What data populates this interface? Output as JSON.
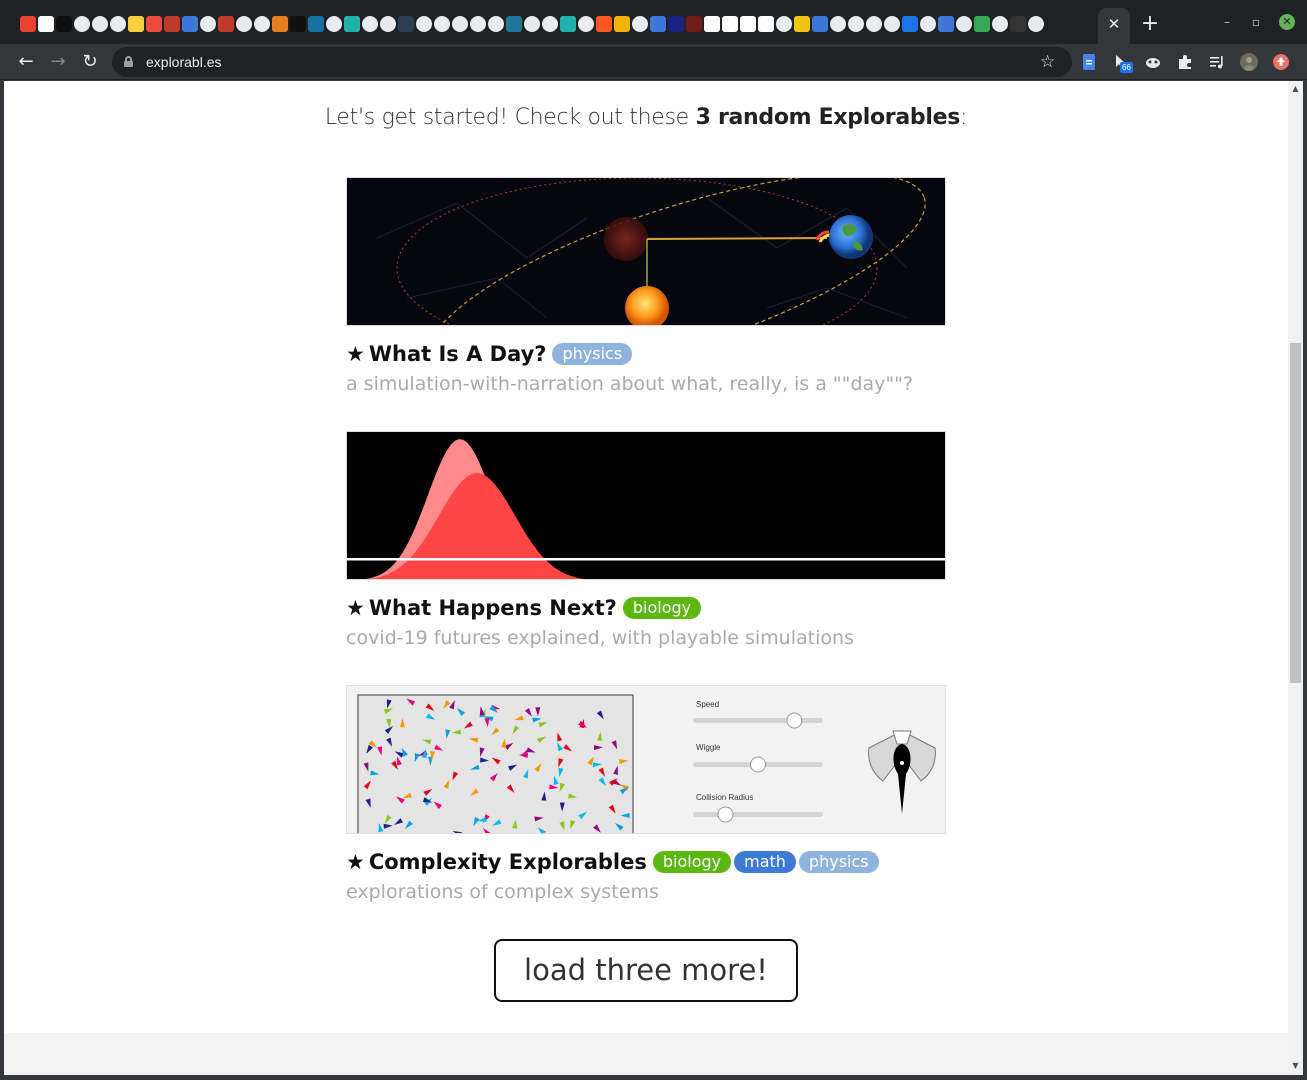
{
  "browser": {
    "url": "explorabl.es",
    "extension_badge": "66",
    "tab_favicon_colors": [
      "#ea4335",
      "#ffffff",
      "#111111",
      "#e8eaed",
      "#e8eaed",
      "#e8eaed",
      "#f4d03f",
      "#e74c3c",
      "#c0392b",
      "#3c78d8",
      "#e8eaed",
      "#c0392b",
      "#e8eaed",
      "#e8eaed",
      "#e67e22",
      "#111111",
      "#1a6fa3",
      "#e8eaed",
      "#20b2aa",
      "#e8eaed",
      "#e8eaed",
      "#2c3e50",
      "#e8eaed",
      "#e8eaed",
      "#e8eaed",
      "#e8eaed",
      "#e8eaed",
      "#21759b",
      "#e8eaed",
      "#e8eaed",
      "#20b2aa",
      "#e8eaed",
      "#ff5722",
      "#f4b400",
      "#e8eaed",
      "#3c78d8",
      "#1a237e",
      "#6d1b1b",
      "#ffffff",
      "#ffffff",
      "#ffffff",
      "#ffffff",
      "#e8eaed",
      "#f1c40f",
      "#3c78d8",
      "#e8eaed",
      "#e8eaed",
      "#e8eaed",
      "#e8eaed",
      "#1a73e8",
      "#e8eaed",
      "#3c78d8",
      "#e8eaed",
      "#34a853",
      "#e8eaed",
      "#333333",
      "#e8eaed"
    ]
  },
  "page": {
    "intro_prefix": "Let's get started! Check out these ",
    "intro_bold": "3 random Explorables",
    "intro_suffix": ":",
    "cards": [
      {
        "star": "★",
        "title": "What Is A Day?",
        "tags": [
          {
            "label": "physics",
            "color": "#8fb3dd"
          }
        ],
        "description": "a simulation-with-narration about what, really, is a \"\"day\"\"?"
      },
      {
        "star": "★",
        "title": "What Happens Next?",
        "tags": [
          {
            "label": "biology",
            "color": "#5cb811"
          }
        ],
        "description": "covid-19 futures explained, with playable simulations"
      },
      {
        "star": "★",
        "title": "Complexity Explorables",
        "tags": [
          {
            "label": "biology",
            "color": "#5cb811"
          },
          {
            "label": "math",
            "color": "#3d7bd6"
          },
          {
            "label": "physics",
            "color": "#8fb3dd"
          }
        ],
        "description": "explorations of complex systems"
      }
    ],
    "complexity_panel": {
      "speed_label": "Speed",
      "wiggle_label": "Wiggle",
      "collision_label": "Collision Radius",
      "speed_value": 0.78,
      "wiggle_value": 0.5,
      "collision_value": 0.25
    },
    "load_more_label": "load three more!"
  }
}
